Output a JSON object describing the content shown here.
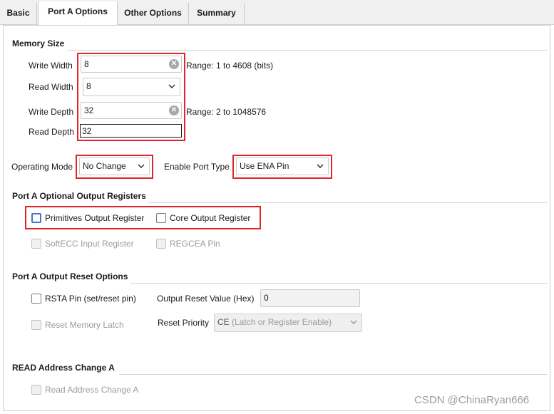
{
  "tabs": [
    "Basic",
    "Port A Options",
    "Other Options",
    "Summary"
  ],
  "memory_size": {
    "title": "Memory Size",
    "write_width_label": "Write Width",
    "write_width_value": "8",
    "write_width_range": "Range: 1 to 4608 (bits)",
    "read_width_label": "Read Width",
    "read_width_value": "8",
    "write_depth_label": "Write Depth",
    "write_depth_value": "32",
    "write_depth_range": "Range: 2 to 1048576",
    "read_depth_label": "Read Depth",
    "read_depth_value": "32"
  },
  "modes": {
    "operating_mode_label": "Operating Mode",
    "operating_mode_value": "No Change",
    "enable_port_type_label": "Enable Port Type",
    "enable_port_type_value": "Use ENA Pin"
  },
  "optional_output": {
    "title": "Port A Optional Output Registers",
    "primitives_label": "Primitives Output Register",
    "core_label": "Core Output Register",
    "softecc_label": "SoftECC Input Register",
    "regcea_label": "REGCEA Pin"
  },
  "reset_options": {
    "title": "Port A Output Reset Options",
    "rsta_label": "RSTA Pin (set/reset pin)",
    "output_reset_value_label": "Output Reset Value (Hex)",
    "output_reset_value": "0",
    "reset_memory_latch_label": "Reset Memory Latch",
    "reset_priority_label": "Reset Priority",
    "reset_priority_value": "CE",
    "reset_priority_value_suffix": "(Latch or Register Enable)"
  },
  "read_address": {
    "title": "READ Address Change A",
    "read_address_change_label": "Read Address Change A"
  },
  "watermark": "CSDN @ChinaRyan666",
  "colors": {
    "highlight": "#e0252b",
    "focus": "#4a78c8"
  }
}
